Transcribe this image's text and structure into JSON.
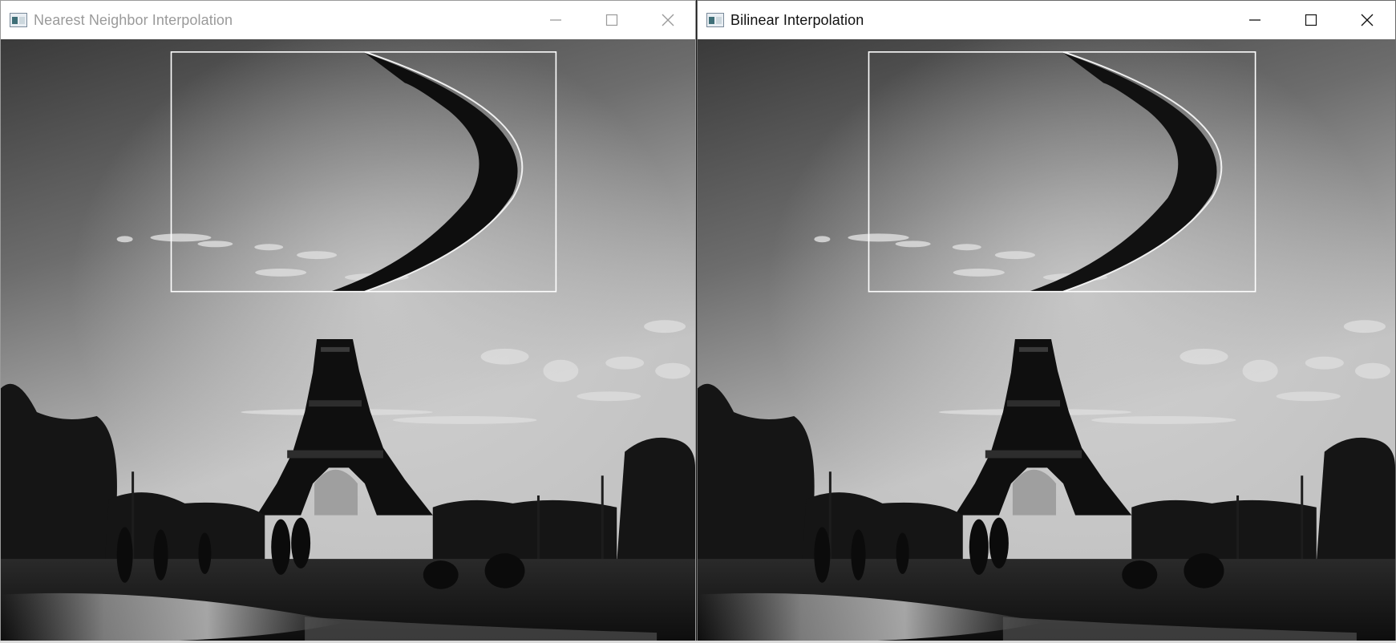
{
  "windows": {
    "left": {
      "title": "Nearest Neighbor Interpolation",
      "icon": "opencv-window-icon",
      "active": false,
      "controls": [
        "minimize-icon",
        "maximize-icon",
        "close-icon"
      ]
    },
    "right": {
      "title": "Bilinear Interpolation",
      "icon": "opencv-window-icon",
      "active": true,
      "controls": [
        "minimize-icon",
        "maximize-icon",
        "close-icon"
      ]
    }
  },
  "colors": {
    "titlebar": "#ffffff",
    "inactive_title": "#9a9a9a",
    "active_title": "#111111",
    "roi_rect": "#ffffff"
  }
}
